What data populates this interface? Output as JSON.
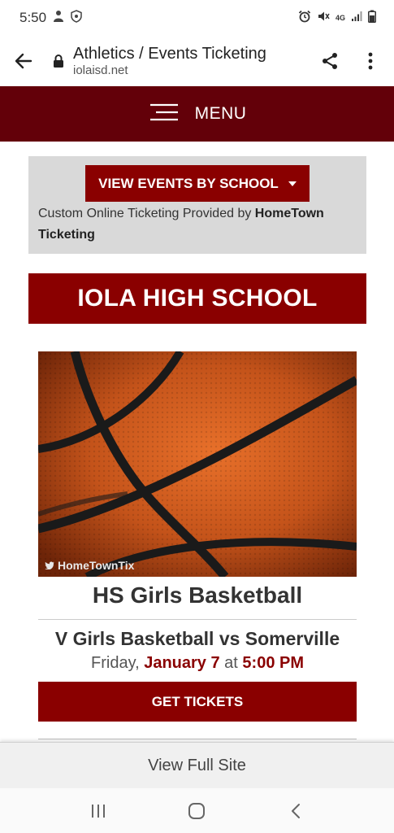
{
  "status_bar": {
    "time": "5:50",
    "icons_left": [
      "person-icon",
      "shield-icon"
    ],
    "icons_right": [
      "alarm-icon",
      "mute-icon",
      "4g-icon",
      "signal-icon",
      "battery-icon"
    ],
    "network": "4G"
  },
  "browser": {
    "page_title": "Athletics / Events Ticketing",
    "domain": "iolaisd.net"
  },
  "nav": {
    "menu_label": "MENU"
  },
  "school_selector": {
    "button_label": "VIEW EVENTS BY SCHOOL",
    "provider_prefix": "Custom Online Ticketing Provided by ",
    "provider_name": "HomeTown Ticketing"
  },
  "school": {
    "name": "IOLA HIGH SCHOOL"
  },
  "event": {
    "image_watermark": "HomeTownTix",
    "category": "HS Girls Basketball",
    "title": "V Girls Basketball vs Somerville",
    "day": "Friday,",
    "date": "January 7",
    "at_word": "at",
    "time": "5:00 PM",
    "button_label": "GET TICKETS"
  },
  "footer": {
    "full_site_label": "View Full Site"
  },
  "colors": {
    "menu_bar": "#630009",
    "accent": "#8a0000",
    "gray_box": "#d9d9d9"
  }
}
